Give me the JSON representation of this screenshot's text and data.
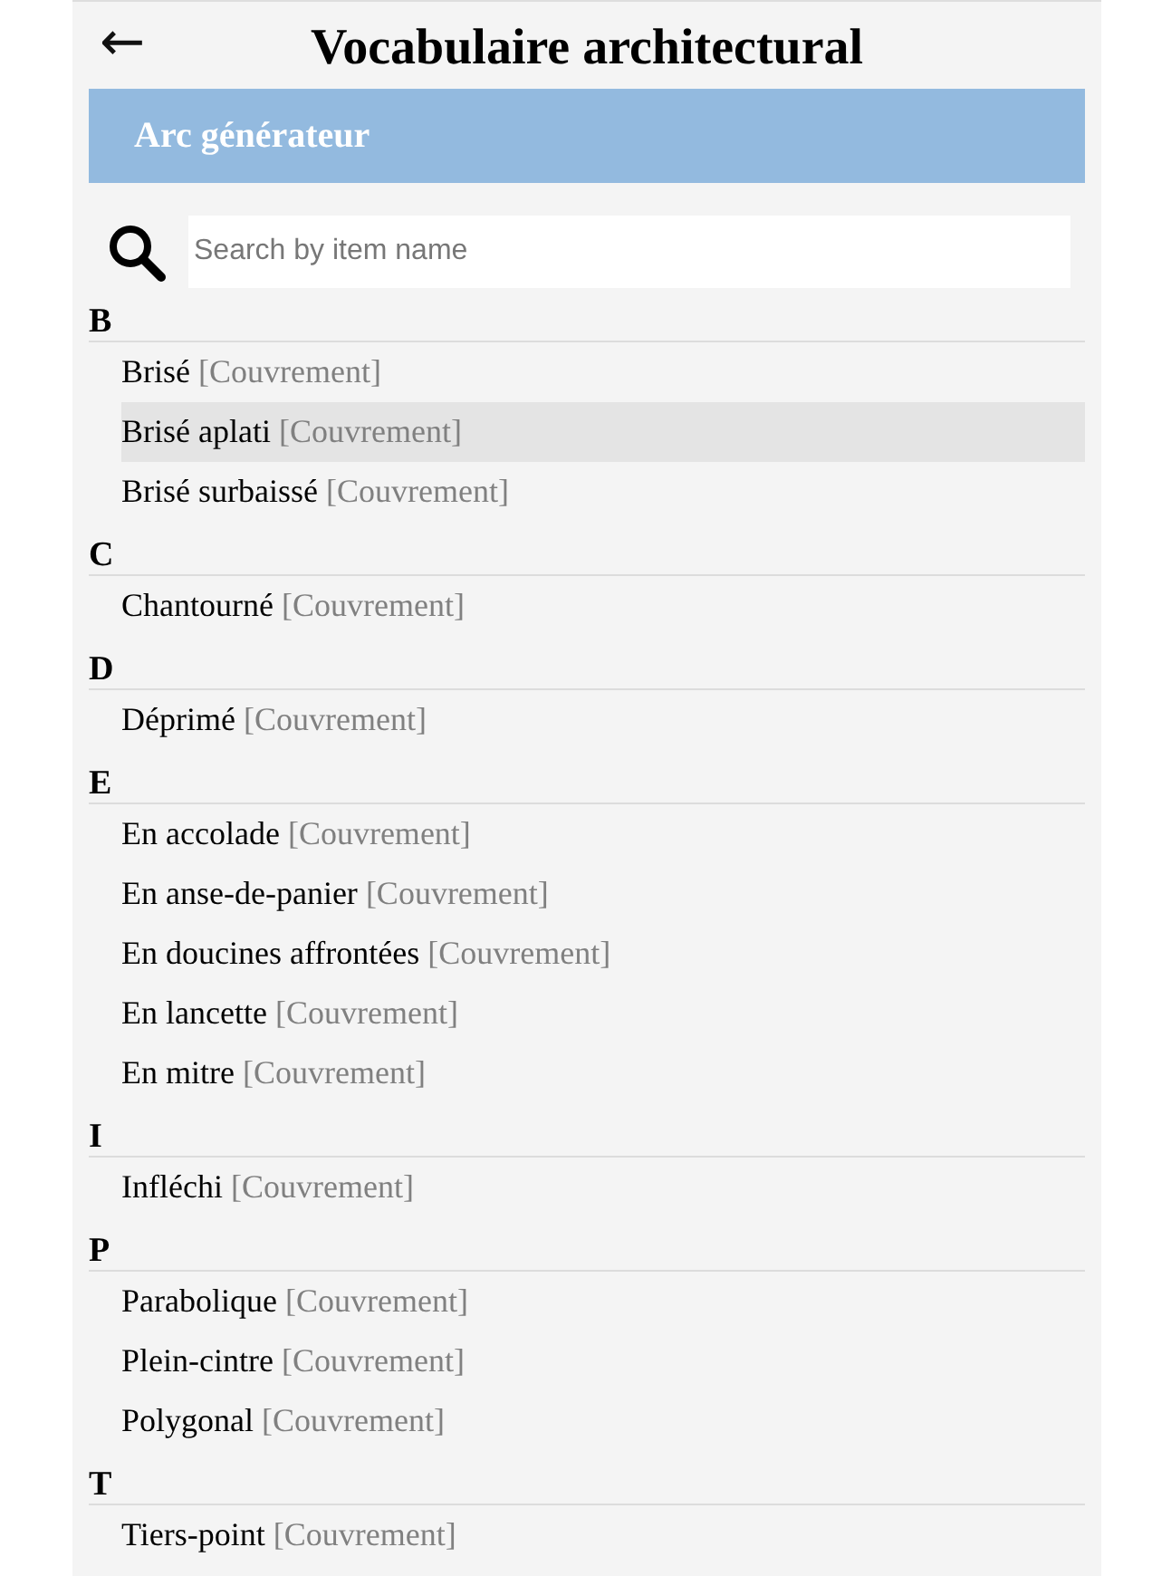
{
  "header": {
    "back": "←",
    "title": "Vocabulaire architectural"
  },
  "banner": "Arc générateur",
  "search": {
    "placeholder": "Search by item name"
  },
  "sections": [
    {
      "letter": "B",
      "items": [
        {
          "name": "Brisé",
          "category": "[Couvrement]",
          "selected": false
        },
        {
          "name": "Brisé aplati",
          "category": "[Couvrement]",
          "selected": true
        },
        {
          "name": "Brisé surbaissé",
          "category": "[Couvrement]",
          "selected": false
        }
      ]
    },
    {
      "letter": "C",
      "items": [
        {
          "name": "Chantourné",
          "category": "[Couvrement]",
          "selected": false
        }
      ]
    },
    {
      "letter": "D",
      "items": [
        {
          "name": "Déprimé",
          "category": "[Couvrement]",
          "selected": false
        }
      ]
    },
    {
      "letter": "E",
      "items": [
        {
          "name": "En accolade",
          "category": "[Couvrement]",
          "selected": false
        },
        {
          "name": "En anse-de-panier",
          "category": "[Couvrement]",
          "selected": false
        },
        {
          "name": "En doucines affrontées",
          "category": "[Couvrement]",
          "selected": false
        },
        {
          "name": "En lancette",
          "category": "[Couvrement]",
          "selected": false
        },
        {
          "name": "En mitre",
          "category": "[Couvrement]",
          "selected": false
        }
      ]
    },
    {
      "letter": "I",
      "items": [
        {
          "name": "Infléchi",
          "category": "[Couvrement]",
          "selected": false
        }
      ]
    },
    {
      "letter": "P",
      "items": [
        {
          "name": "Parabolique",
          "category": "[Couvrement]",
          "selected": false
        },
        {
          "name": "Plein-cintre",
          "category": "[Couvrement]",
          "selected": false
        },
        {
          "name": "Polygonal",
          "category": "[Couvrement]",
          "selected": false
        }
      ]
    },
    {
      "letter": "T",
      "items": [
        {
          "name": "Tiers-point",
          "category": "[Couvrement]",
          "selected": false
        }
      ]
    }
  ]
}
